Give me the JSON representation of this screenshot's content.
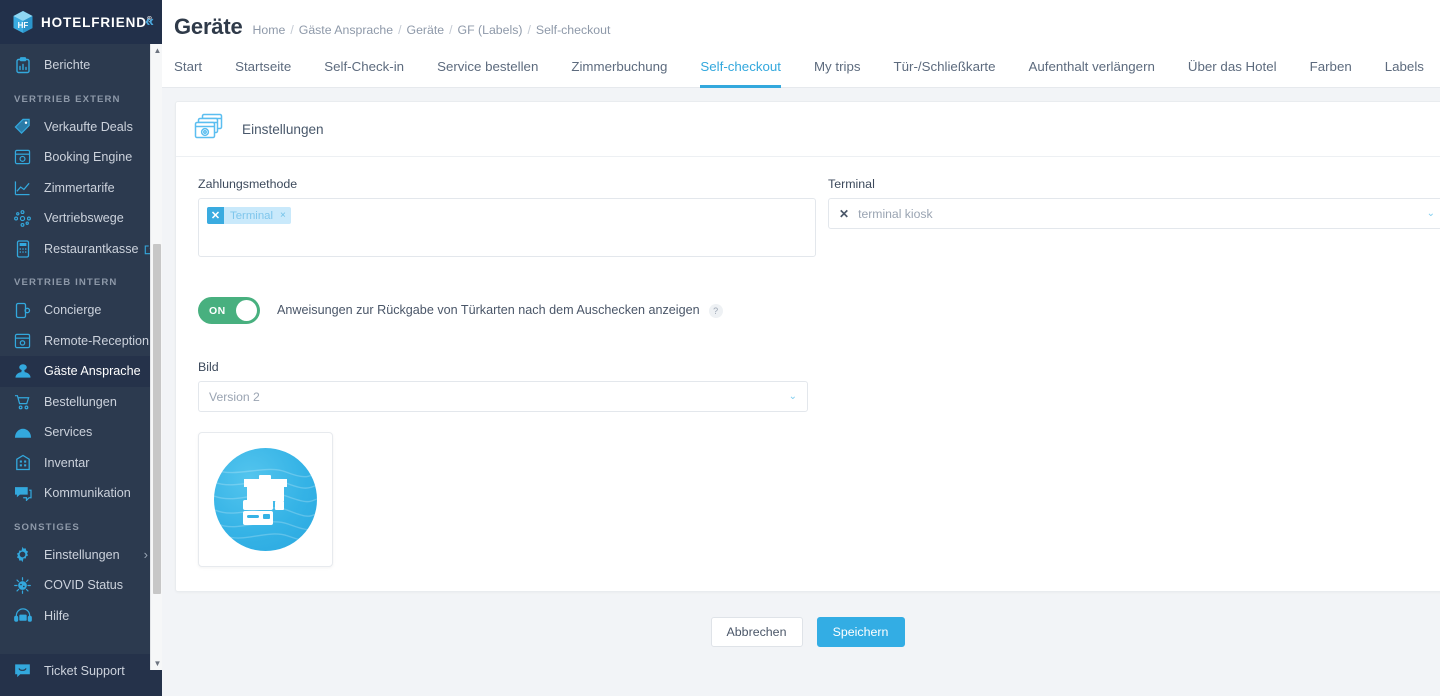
{
  "brand": {
    "name": "HOTELFRIEND",
    "registered_mark": "®",
    "collapse_icon": "chevron-double-left-icon",
    "accent_blue": "#33a8dd",
    "sidebar_bg": "#2c3a4f",
    "logo_bg": "#22304a"
  },
  "sidebar": {
    "top_items": [
      {
        "label": "Berichte",
        "icon": "clipboard-report-icon"
      }
    ],
    "sections": [
      {
        "title": "VERTRIEB EXTERN",
        "items": [
          {
            "label": "Verkaufte Deals",
            "icon": "tag-icon",
            "external": false,
            "chevron": false
          },
          {
            "label": "Booking Engine",
            "icon": "browser-gear-icon",
            "external": false,
            "chevron": false
          },
          {
            "label": "Zimmertarife",
            "icon": "chart-line-icon",
            "external": false,
            "chevron": false
          },
          {
            "label": "Vertriebswege",
            "icon": "network-nodes-icon",
            "external": false,
            "chevron": false
          },
          {
            "label": "Restaurantkasse",
            "icon": "pos-terminal-icon",
            "external": true,
            "chevron": false
          }
        ]
      },
      {
        "title": "VERTRIEB INTERN",
        "items": [
          {
            "label": "Concierge",
            "icon": "mobile-concierge-icon",
            "external": false,
            "chevron": false
          },
          {
            "label": "Remote-Reception",
            "icon": "remote-reception-icon",
            "external": false,
            "chevron": false
          },
          {
            "label": "Gäste Ansprache",
            "icon": "guest-speech-icon",
            "external": false,
            "chevron": false,
            "active": true
          },
          {
            "label": "Bestellungen",
            "icon": "shopping-cart-icon",
            "external": false,
            "chevron": false
          },
          {
            "label": "Services",
            "icon": "service-bell-icon",
            "external": false,
            "chevron": false
          },
          {
            "label": "Inventar",
            "icon": "inventory-grid-icon",
            "external": false,
            "chevron": false
          },
          {
            "label": "Kommunikation",
            "icon": "chat-bubble-icon",
            "external": false,
            "chevron": false
          }
        ]
      },
      {
        "title": "SONSTIGES",
        "items": [
          {
            "label": "Einstellungen",
            "icon": "gear-icon",
            "external": false,
            "chevron": true
          },
          {
            "label": "COVID Status",
            "icon": "virus-icon",
            "external": false,
            "chevron": false
          },
          {
            "label": "Hilfe",
            "icon": "headset-24-icon",
            "external": false,
            "chevron": false
          }
        ]
      }
    ],
    "bottom_items": [
      {
        "label": "Ticket Support",
        "icon": "support-chat-icon"
      }
    ],
    "scrollbar": {
      "up_arrow": "▲",
      "down_arrow": "▼"
    }
  },
  "header": {
    "title": "Geräte",
    "breadcrumb": [
      "Home",
      "Gäste Ansprache",
      "Geräte",
      "GF (Labels)",
      "Self-checkout"
    ],
    "breadcrumb_separator": "/"
  },
  "tabs": [
    {
      "label": "Start",
      "active": false
    },
    {
      "label": "Startseite",
      "active": false
    },
    {
      "label": "Self-Check-in",
      "active": false
    },
    {
      "label": "Service bestellen",
      "active": false
    },
    {
      "label": "Zimmerbuchung",
      "active": false
    },
    {
      "label": "Self-checkout",
      "active": true
    },
    {
      "label": "My trips",
      "active": false
    },
    {
      "label": "Tür-/Schließkarte",
      "active": false
    },
    {
      "label": "Aufenthalt verlängern",
      "active": false
    },
    {
      "label": "Über das Hotel",
      "active": false
    },
    {
      "label": "Farben",
      "active": false
    },
    {
      "label": "Labels",
      "active": false
    }
  ],
  "settings_card": {
    "header_title": "Einstellungen",
    "header_icon": "settings-screens-icon",
    "payment_method": {
      "label": "Zahlungsmethode",
      "tags": [
        {
          "text": "Terminal",
          "remove_glyph": "×",
          "prefix_glyph": "✕"
        }
      ],
      "placeholder": ""
    },
    "terminal": {
      "label": "Terminal",
      "value": "terminal kiosk",
      "clear_glyph": "✕",
      "caret_glyph": "⌄"
    },
    "toggle": {
      "state_label": "ON",
      "on": true,
      "description": "Anweisungen zur Rückgabe von Türkarten nach dem Auschecken anzeigen",
      "help_glyph": "?"
    },
    "image": {
      "label": "Bild",
      "selected_version": "Version 2",
      "caret_glyph": "⌄",
      "preview_icon": "package-card-circle-icon"
    }
  },
  "actions": {
    "cancel_label": "Abbrechen",
    "save_label": "Speichern",
    "save_color": "#33ade4"
  }
}
